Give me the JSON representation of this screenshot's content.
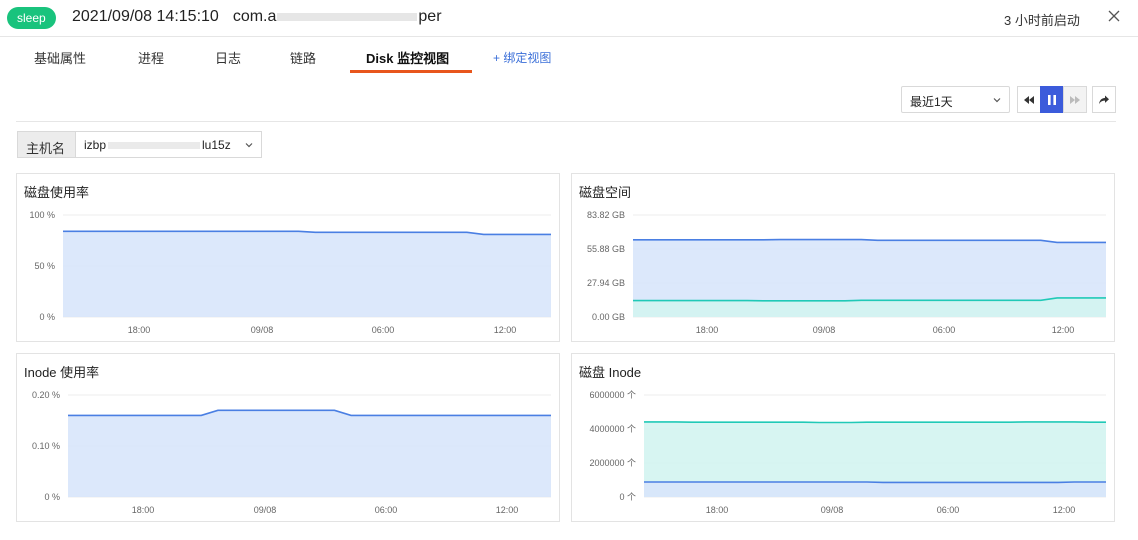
{
  "header": {
    "status_badge": "sleep",
    "timestamp": "2021/09/08 14:15:10",
    "app_name_prefix": "com.a",
    "app_name_suffix": "per",
    "started": "3 小时前启动",
    "close_icon": "close-icon"
  },
  "tabs": [
    {
      "label": "基础属性",
      "active": false
    },
    {
      "label": "进程",
      "active": false
    },
    {
      "label": "日志",
      "active": false
    },
    {
      "label": "链路",
      "active": false
    },
    {
      "label": "Disk 监控视图",
      "active": true
    }
  ],
  "tab_add": {
    "label": "+ 绑定视图"
  },
  "toolbar": {
    "range_selected": "最近1天",
    "buttons": [
      {
        "name": "rewind-button",
        "icon": "rewind-icon",
        "state": "normal"
      },
      {
        "name": "pause-button",
        "icon": "pause-icon",
        "state": "active"
      },
      {
        "name": "forward-button",
        "icon": "fast-forward-icon",
        "state": "disabled"
      },
      {
        "name": "share-button",
        "icon": "share-icon",
        "state": "normal"
      }
    ]
  },
  "host": {
    "label": "主机名",
    "value_prefix": "izbp",
    "value_suffix": "lu15z"
  },
  "colors": {
    "blue_line": "#4a7fe3",
    "blue_fill": "#d8e5fb",
    "teal_line": "#21c9b7",
    "teal_fill": "#d3f4f1",
    "accent_tab": "#e8561c",
    "badge": "#19c37d"
  },
  "chart_data": [
    {
      "title": "磁盘使用率",
      "type": "area",
      "unit": "%",
      "yticks": [
        "100 %",
        "50 %",
        "0 %"
      ],
      "ylim": [
        0,
        100
      ],
      "xticks": [
        "18:00",
        "09/08",
        "06:00",
        "12:00"
      ],
      "series": [
        {
          "values": [
            84,
            84,
            84,
            84,
            84,
            84,
            84,
            84,
            84,
            84,
            84,
            84,
            84,
            84,
            84,
            83,
            83,
            83,
            83,
            83,
            83,
            83,
            83,
            83,
            83,
            81,
            81,
            81,
            81,
            81
          ]
        }
      ]
    },
    {
      "title": "磁盘空间",
      "type": "area",
      "unit": "GB",
      "yticks": [
        "83.82 GB",
        "55.88 GB",
        "27.94 GB",
        "0.00 GB"
      ],
      "ylim": [
        0,
        83.82
      ],
      "xticks": [
        "18:00",
        "09/08",
        "06:00",
        "12:00"
      ],
      "series": [
        {
          "values": [
            63.4,
            63.4,
            63.4,
            63.4,
            63.4,
            63.4,
            63.4,
            63.4,
            63.4,
            63.6,
            63.6,
            63.6,
            63.6,
            63.6,
            63.6,
            63.0,
            63.0,
            63.0,
            63.0,
            63.0,
            63.0,
            63.0,
            63.0,
            63.0,
            63.0,
            63.0,
            61.3,
            61.3,
            61.3,
            61.3
          ]
        },
        {
          "values": [
            13.5,
            13.5,
            13.5,
            13.5,
            13.5,
            13.5,
            13.5,
            13.5,
            13.3,
            13.3,
            13.3,
            13.3,
            13.3,
            13.3,
            13.7,
            13.7,
            13.7,
            13.7,
            13.7,
            13.7,
            13.7,
            13.7,
            13.7,
            13.7,
            13.7,
            13.7,
            15.7,
            15.7,
            15.7,
            15.7
          ]
        }
      ]
    },
    {
      "title": "Inode 使用率",
      "type": "area",
      "unit": "%",
      "yticks": [
        "0.20 %",
        "0.10 %",
        "0 %"
      ],
      "ylim": [
        0,
        0.2
      ],
      "xticks": [
        "18:00",
        "09/08",
        "06:00",
        "12:00"
      ],
      "series": [
        {
          "values": [
            0.16,
            0.16,
            0.16,
            0.16,
            0.16,
            0.16,
            0.16,
            0.16,
            0.16,
            0.17,
            0.17,
            0.17,
            0.17,
            0.17,
            0.17,
            0.17,
            0.17,
            0.16,
            0.16,
            0.16,
            0.16,
            0.16,
            0.16,
            0.16,
            0.16,
            0.16,
            0.16,
            0.16,
            0.16,
            0.16
          ]
        }
      ]
    },
    {
      "title": "磁盘 Inode",
      "type": "area",
      "unit": "个",
      "yticks": [
        "6000000 个",
        "4000000 个",
        "2000000 个",
        "0 个"
      ],
      "ylim": [
        0,
        6000000
      ],
      "xticks": [
        "18:00",
        "09/08",
        "06:00",
        "12:00"
      ],
      "series": [
        {
          "values": [
            4420000,
            4420000,
            4420000,
            4400000,
            4400000,
            4400000,
            4400000,
            4400000,
            4400000,
            4400000,
            4400000,
            4380000,
            4380000,
            4380000,
            4400000,
            4400000,
            4400000,
            4400000,
            4400000,
            4400000,
            4400000,
            4400000,
            4400000,
            4400000,
            4420000,
            4420000,
            4420000,
            4420000,
            4400000,
            4400000
          ]
        },
        {
          "values": [
            880000,
            880000,
            880000,
            880000,
            880000,
            880000,
            880000,
            880000,
            880000,
            880000,
            880000,
            880000,
            880000,
            880000,
            880000,
            860000,
            860000,
            860000,
            860000,
            860000,
            860000,
            860000,
            860000,
            860000,
            860000,
            860000,
            860000,
            880000,
            880000,
            880000
          ]
        }
      ]
    }
  ]
}
